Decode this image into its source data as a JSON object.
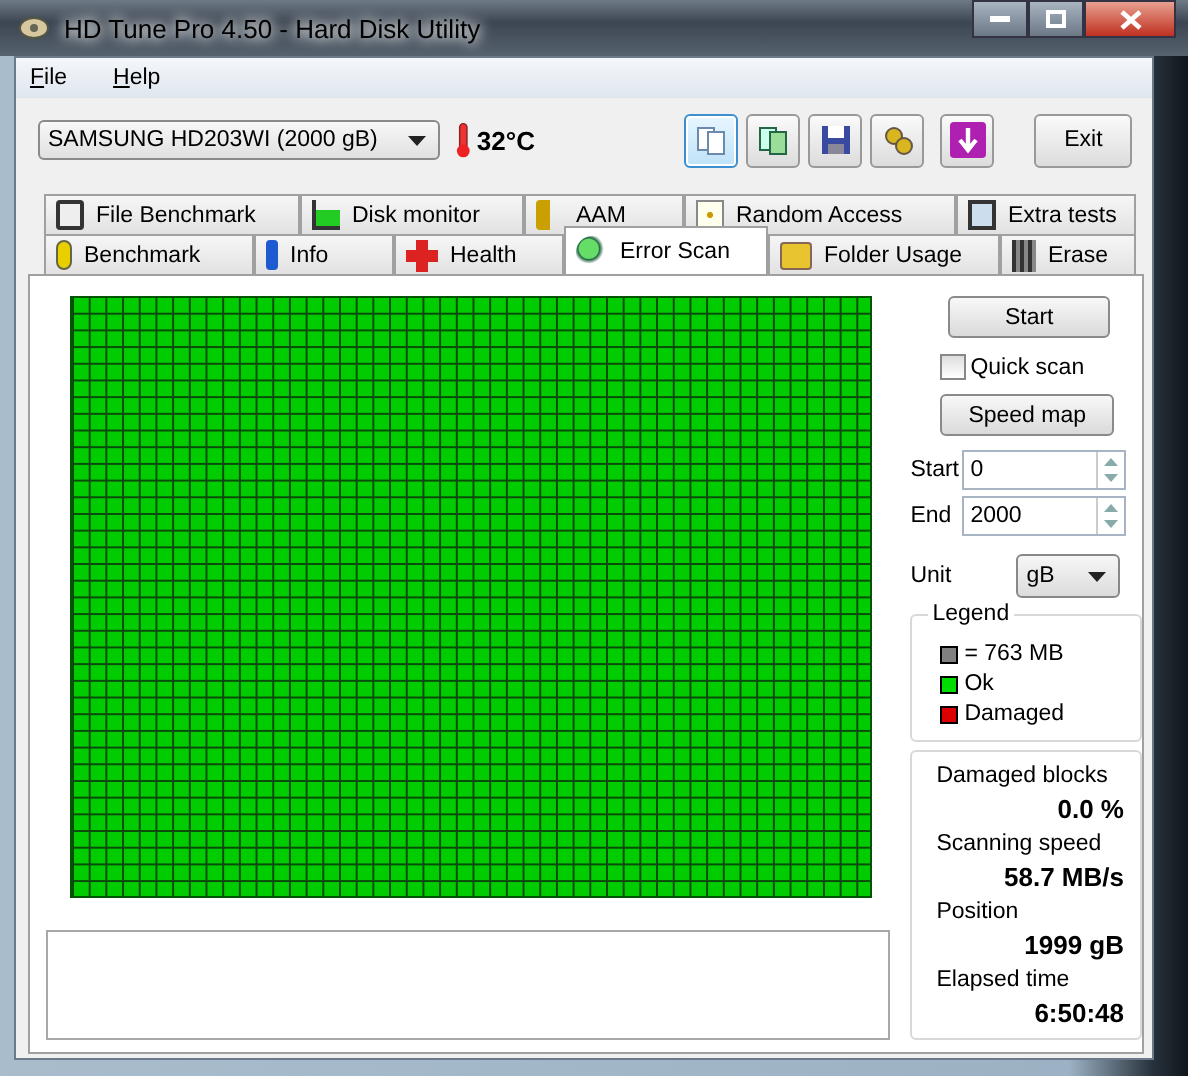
{
  "window": {
    "title": "HD Tune Pro 4.50 - Hard Disk Utility"
  },
  "menu": [
    {
      "label": "File"
    },
    {
      "label": "Help"
    }
  ],
  "drive_select": {
    "value": "SAMSUNG HD203WI (2000 gB)"
  },
  "temperature": "32°C",
  "toolbar_buttons": [
    {
      "selected": true
    },
    {
      "selected": false
    },
    {
      "selected": false
    },
    {
      "selected": false
    },
    {
      "selected": false
    }
  ],
  "exit_button": "Exit",
  "tabs_top": [
    {
      "label": "File Benchmark",
      "selected": false
    },
    {
      "label": "Disk monitor",
      "selected": false
    },
    {
      "label": "AAM",
      "selected": false
    },
    {
      "label": "Random Access",
      "selected": false
    },
    {
      "label": "Extra tests",
      "selected": false
    }
  ],
  "tabs_bottom": [
    {
      "label": "Benchmark",
      "selected": false
    },
    {
      "label": "Info",
      "selected": false
    },
    {
      "label": "Health",
      "selected": false
    },
    {
      "label": "Error Scan",
      "selected": true
    },
    {
      "label": "Folder Usage",
      "selected": false
    },
    {
      "label": "Erase",
      "selected": false
    }
  ],
  "controls": {
    "start_button": "Start",
    "quick_scan": {
      "label": "Quick scan",
      "checked": false
    },
    "speed_map_button": "Speed map",
    "start": {
      "label": "Start",
      "value": "0"
    },
    "end": {
      "label": "End",
      "value": "2000"
    },
    "unit": {
      "label": "Unit",
      "value": "gB"
    }
  },
  "legend": {
    "title": "Legend",
    "items": [
      {
        "label": "= 763 MB",
        "color": "#808080"
      },
      {
        "label": "Ok",
        "color": "#00dd00"
      },
      {
        "label": "Damaged",
        "color": "#dd0000"
      }
    ]
  },
  "stats": [
    {
      "label": "Damaged blocks",
      "value": "0.0 %"
    },
    {
      "label": "Scanning speed",
      "value": "58.7 MB/s"
    },
    {
      "label": "Position",
      "value": "1999 gB"
    },
    {
      "label": "Elapsed time",
      "value": "6:50:48"
    }
  ]
}
